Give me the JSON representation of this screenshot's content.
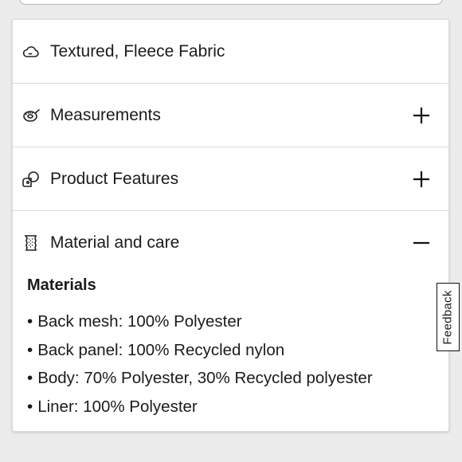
{
  "accordion": {
    "items": [
      {
        "label": "Textured, Fleece Fabric",
        "icon": "cloud-icon",
        "expandable": false
      },
      {
        "label": "Measurements",
        "icon": "measuring-tape-icon",
        "expandable": true,
        "state": "collapsed"
      },
      {
        "label": "Product Features",
        "icon": "features-icon",
        "expandable": true,
        "state": "collapsed"
      },
      {
        "label": "Material and care",
        "icon": "fabric-swatch-icon",
        "expandable": true,
        "state": "expanded"
      }
    ],
    "materials": {
      "heading": "Materials",
      "lines": [
        "Back mesh: 100% Polyester",
        "Back panel: 100% Recycled nylon",
        "Body: 70% Polyester, 30% Recycled polyester",
        "Liner: 100% Polyester"
      ]
    }
  },
  "feedback_tab": {
    "label": "Feedback"
  }
}
